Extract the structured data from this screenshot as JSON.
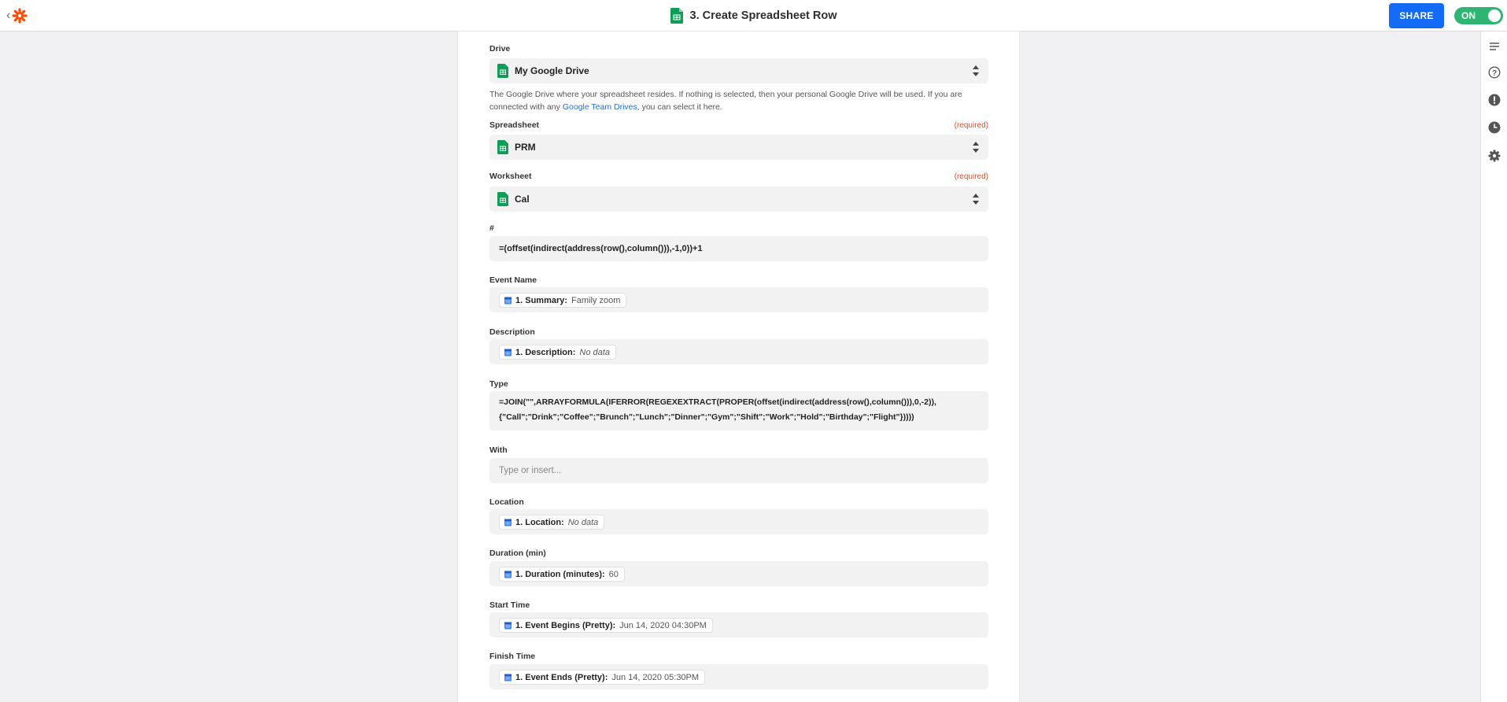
{
  "header": {
    "title": "3. Create Spreadsheet Row",
    "share_label": "SHARE",
    "toggle_label": "ON"
  },
  "colors": {
    "accent_blue": "#136bf5",
    "toggle_green": "#2fb573",
    "zapier_orange": "#ff4a00",
    "sheets_green": "#0f9d58",
    "required_red": "#e5491f"
  },
  "rail": [
    "details-icon",
    "help-icon",
    "alert-icon",
    "history-icon",
    "gear-icon"
  ],
  "form": {
    "drive": {
      "label": "Drive",
      "value": "My Google Drive",
      "help_before": "The Google Drive where your spreadsheet resides. If nothing is selected, then your personal Google Drive will be used. If you are connected with any ",
      "help_link": "Google Team Drives",
      "help_after": ", you can select it here."
    },
    "spreadsheet": {
      "label": "Spreadsheet",
      "required": "(required)",
      "value": "PRM"
    },
    "worksheet": {
      "label": "Worksheet",
      "required": "(required)",
      "value": "Cal"
    },
    "number": {
      "label": "#",
      "value": "=(offset(indirect(address(row(),column())),-1,0))+1"
    },
    "event_name": {
      "label": "Event Name",
      "pill_key": "1. Summary:",
      "pill_value": "Family zoom"
    },
    "description": {
      "label": "Description",
      "pill_key": "1. Description:",
      "pill_value": "No data"
    },
    "type": {
      "label": "Type",
      "line1": "=JOIN(\"\",ARRAYFORMULA(IFERROR(REGEXEXTRACT(PROPER(offset(indirect(address(row(),column())),0,-2)),",
      "line2": "{\"Call\";\"Drink\";\"Coffee\";\"Brunch\";\"Lunch\";\"Dinner\";\"Gym\";\"Shift\";\"Work\";\"Hold\";\"Birthday\";\"Flight\"}))))"
    },
    "with": {
      "label": "With",
      "placeholder": "Type or insert..."
    },
    "location": {
      "label": "Location",
      "pill_key": "1. Location:",
      "pill_value": "No data"
    },
    "duration": {
      "label": "Duration (min)",
      "pill_key": "1. Duration (minutes):",
      "pill_value": "60"
    },
    "start_time": {
      "label": "Start Time",
      "pill_key": "1. Event Begins (Pretty):",
      "pill_value": "Jun 14, 2020 04:30PM"
    },
    "finish_time": {
      "label": "Finish Time",
      "pill_key": "1. Event Ends (Pretty):",
      "pill_value": "Jun 14, 2020 05:30PM"
    }
  }
}
